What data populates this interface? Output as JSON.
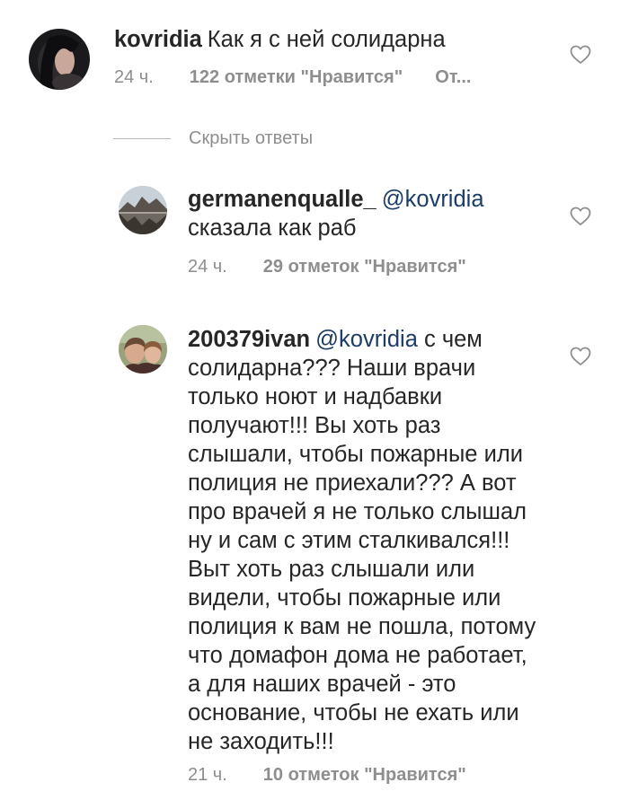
{
  "comments": [
    {
      "username": "kovridia",
      "text": "Как я с ней солидарна",
      "mention": "",
      "time": "24 ч.",
      "likes": "122 отметки \"Нравится\"",
      "reply": "От..."
    }
  ],
  "hide_replies": {
    "label": "Скрыть ответы"
  },
  "replies": [
    {
      "username": "germanenqualle_",
      "mention": "@kovridia",
      "text": "сказала как раб",
      "time": "24 ч.",
      "likes": "29 отметок \"Нравится\""
    },
    {
      "username": "200379ivan",
      "mention": "@kovridia",
      "text": "с чем солидарна??? Наши врачи только ноют и надбавки получают!!! Вы хоть раз слышали, чтобы пожарные или полиция не приехали??? А вот про врачей я не только слышал ну и сам с этим сталкивался!!! Выт хоть раз слышали или видели, чтобы пожарные или полиция к вам не пошла, потому что домафон дома не работает, а для наших врачей - это основание, чтобы не ехать или не заходить!!!",
      "time": "21 ч.",
      "likes": "10 отметок \"Нравится\""
    }
  ],
  "icons": {
    "like": "heart-outline-icon"
  },
  "colors": {
    "text": "#262626",
    "meta": "#8e8e8e",
    "mention": "#1c3d68",
    "divider": "#b8b8b8"
  }
}
